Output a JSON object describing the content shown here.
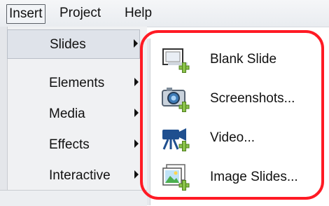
{
  "menubar": {
    "items": [
      {
        "label": "Insert"
      },
      {
        "label": "Project"
      },
      {
        "label": "Help"
      }
    ]
  },
  "insert_menu": {
    "items": [
      {
        "label": "Slides",
        "active": true
      },
      {
        "label": "Elements"
      },
      {
        "label": "Media"
      },
      {
        "label": "Effects"
      },
      {
        "label": "Interactive"
      }
    ]
  },
  "slides_menu": {
    "items": [
      {
        "label": "Blank Slide",
        "icon": "blank-slide-icon"
      },
      {
        "label": "Screenshots...",
        "icon": "camera-icon"
      },
      {
        "label": "Video...",
        "icon": "video-camera-icon"
      },
      {
        "label": "Image Slides...",
        "icon": "image-slides-icon"
      }
    ]
  },
  "colors": {
    "highlight": "#ff1a24",
    "plus_badge": "#8bc34a"
  }
}
